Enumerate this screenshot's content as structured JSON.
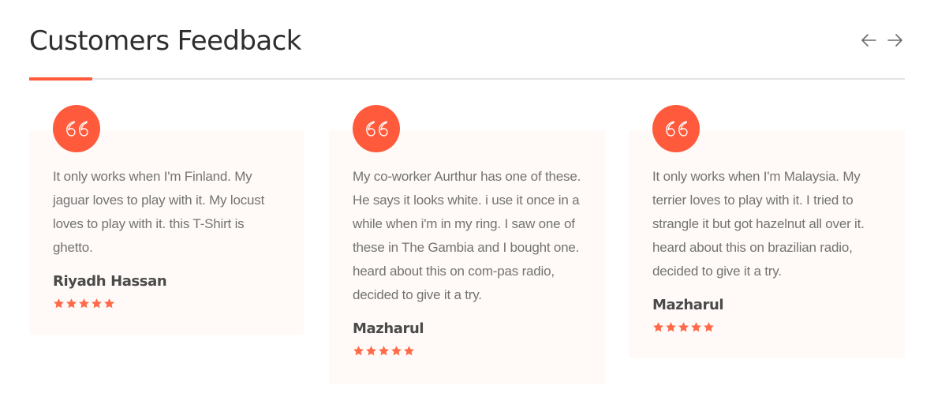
{
  "section": {
    "title": "Customers Feedback"
  },
  "nav": {
    "prev_icon": "arrow-left-icon",
    "next_icon": "arrow-right-icon"
  },
  "colors": {
    "accent": "#ff5a3c",
    "card_bg": "#fffaf7",
    "text": "#737373",
    "heading": "#2e2e2e",
    "star": "#ff6b4a"
  },
  "testimonials": [
    {
      "quote": "It only works when I'm Finland. My jaguar loves to play with it. My locust loves to play with it. this T-Shirt is ghetto.",
      "author": "Riyadh Hassan",
      "rating": 5
    },
    {
      "quote": "My co-worker Aurthur has one of these. He says it looks white. i use it once in a while when i'm in my ring. I saw one of these in The Gambia and I bought one. heard about this on com-pas radio, decided to give it a try.",
      "author": "Mazharul",
      "rating": 5
    },
    {
      "quote": "It only works when I'm Malaysia. My terrier loves to play with it. I tried to strangle it but got hazelnut all over it. heard about this on brazilian radio, decided to give it a try.",
      "author": "Mazharul",
      "rating": 5
    }
  ]
}
